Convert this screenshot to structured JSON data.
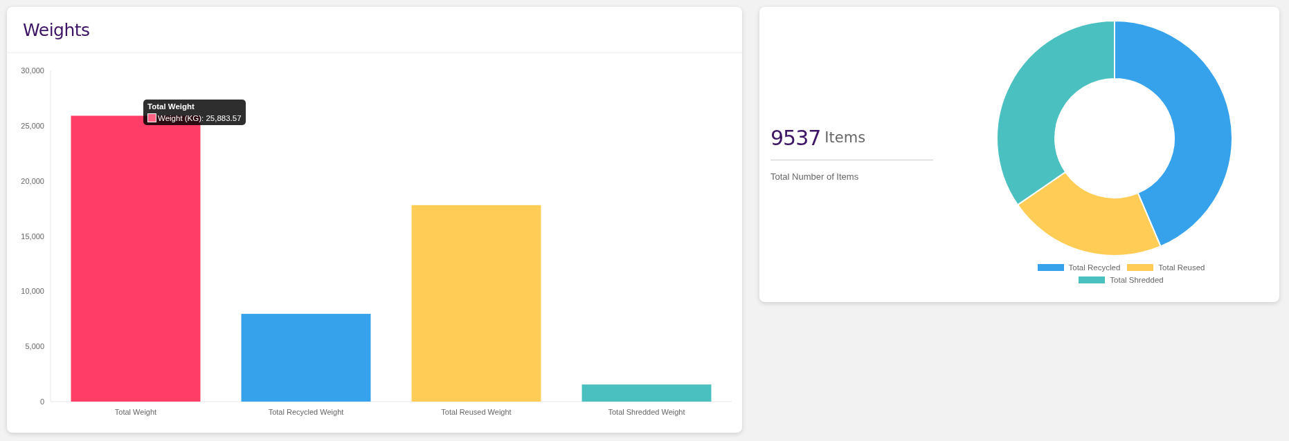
{
  "weights_card": {
    "title": "Weights",
    "chart_data": {
      "type": "bar",
      "categories": [
        "Total Weight",
        "Total Recycled Weight",
        "Total Reused Weight",
        "Total Shredded Weight"
      ],
      "series": [
        {
          "name": "Weight (KG)",
          "values": [
            25900,
            7950,
            17800,
            1550
          ],
          "colors": [
            "#ff3d67",
            "#36a2eb",
            "#ffcd56",
            "#4bc0c0"
          ]
        }
      ],
      "ylim": [
        0,
        30000
      ],
      "yticks": [
        {
          "value": 0,
          "label": "0"
        },
        {
          "value": 5000,
          "label": "5,000"
        },
        {
          "value": 10000,
          "label": "10,000"
        },
        {
          "value": 15000,
          "label": "15,000"
        },
        {
          "value": 20000,
          "label": "20,000"
        },
        {
          "value": 25000,
          "label": "25,000"
        },
        {
          "value": 30000,
          "label": "30,000"
        }
      ]
    },
    "tooltip": {
      "title": "Total Weight",
      "separator": ":",
      "value": "25,883.57",
      "color": "#ff6384"
    }
  },
  "items_card": {
    "count": "9537",
    "unit": "Items",
    "caption": "Total Number of Items",
    "legend": [
      {
        "label": "Total Recycled",
        "color": "#36a2eb"
      },
      {
        "label": "Total Reused",
        "color": "#ffcd56"
      },
      {
        "label": "Total Shredded",
        "color": "#4bc0c0"
      }
    ]
  }
}
